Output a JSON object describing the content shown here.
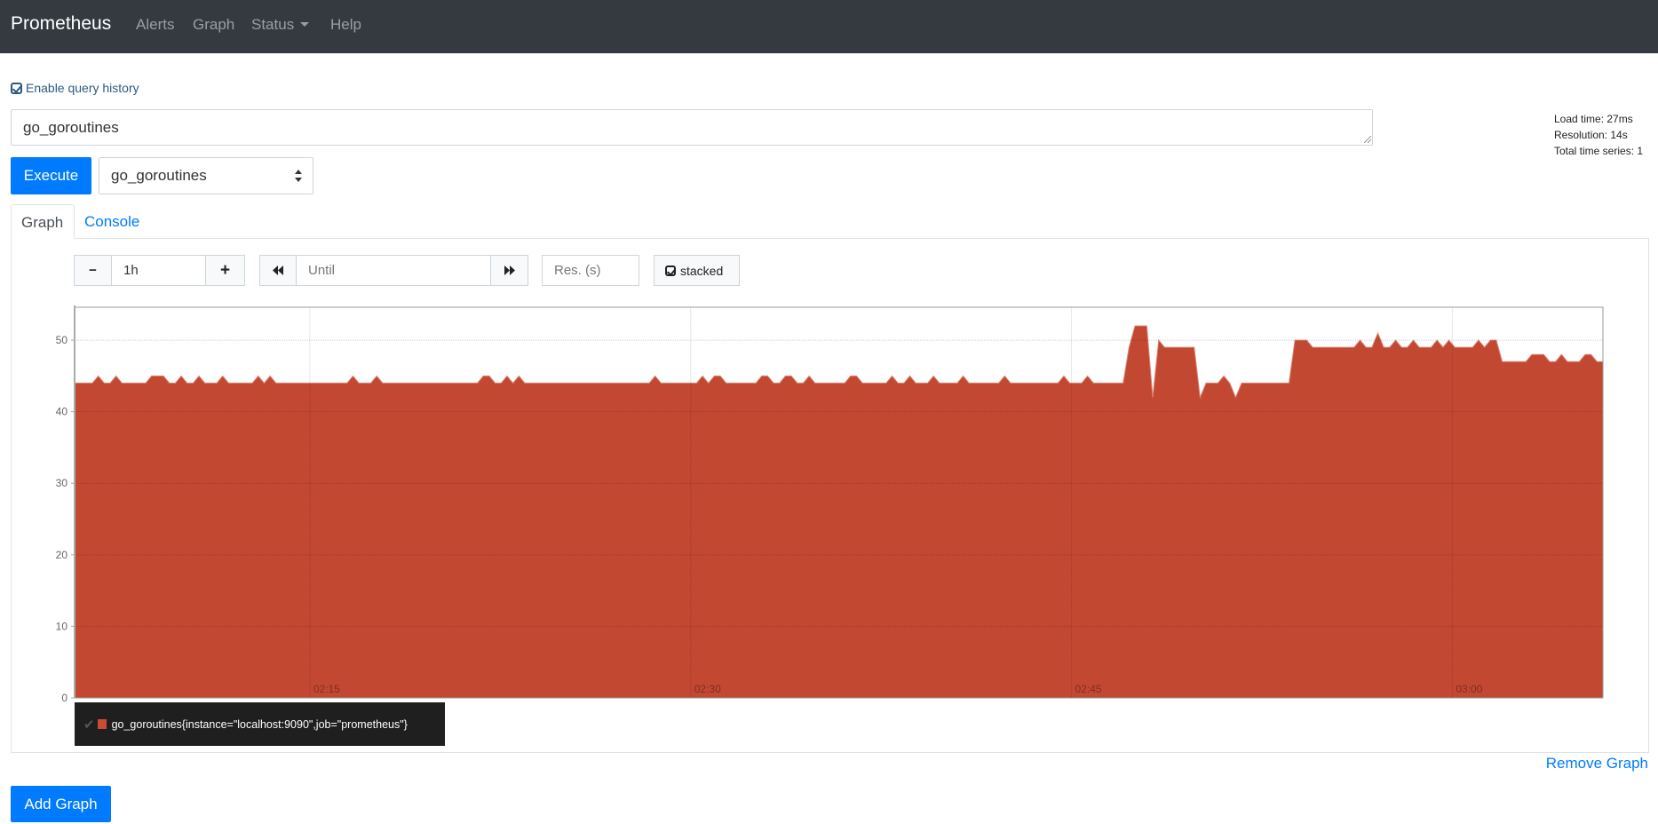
{
  "navbar": {
    "brand": "Prometheus",
    "links": [
      {
        "label": "Alerts"
      },
      {
        "label": "Graph"
      },
      {
        "label": "Status",
        "dropdown": true
      },
      {
        "label": "Help"
      }
    ]
  },
  "query_history": {
    "label": "Enable query history",
    "checked": true,
    "icon": "check-square-icon"
  },
  "query": {
    "value": "go_goroutines"
  },
  "execute_label": "Execute",
  "metric_select": {
    "selected": "go_goroutines"
  },
  "stats": {
    "load_time": "Load time: 27ms",
    "resolution": "Resolution: 14s",
    "total_series": "Total time series: 1"
  },
  "tabs": [
    {
      "label": "Graph",
      "active": true
    },
    {
      "label": "Console",
      "active": false
    }
  ],
  "controls": {
    "minus": "−",
    "range_value": "1h",
    "plus": "+",
    "rewind_icon": "fast-backward-icon",
    "until_placeholder": "Until",
    "forward_icon": "fast-forward-icon",
    "res_placeholder": "Res. (s)",
    "stacked_label": "stacked",
    "stacked_checked": true
  },
  "chart_data": {
    "type": "area",
    "title": "",
    "xlabel": "",
    "ylabel": "",
    "ylim": [
      0,
      54.6
    ],
    "y_ticks": [
      "0",
      "10",
      "20",
      "30",
      "40",
      "50"
    ],
    "y_tick_values": [
      0,
      10,
      20,
      30,
      40,
      50
    ],
    "x_ticks": [
      "02:15",
      "02:30",
      "02:45",
      "03:00"
    ],
    "x_tick_seconds": [
      8100,
      9000,
      9900,
      10800
    ],
    "start_seconds": 7544,
    "step_seconds": 14,
    "grid": true,
    "stacked": true,
    "series": [
      {
        "name": "go_goroutines{instance=\"localhost:9090\",job=\"prometheus\"}",
        "color": "#c24832",
        "values": [
          44,
          44,
          44,
          44,
          45,
          44,
          44,
          45,
          44,
          44,
          44,
          44,
          44,
          45,
          45,
          45,
          44,
          44,
          45,
          44,
          44,
          45,
          44,
          44,
          44,
          45,
          44,
          44,
          44,
          44,
          44,
          45,
          44,
          45,
          44,
          44,
          44,
          44,
          44,
          44,
          44,
          44,
          44,
          44,
          44,
          44,
          44,
          45,
          44,
          44,
          44,
          45,
          44,
          44,
          44,
          44,
          44,
          44,
          44,
          44,
          44,
          44,
          44,
          44,
          44,
          44,
          44,
          44,
          44,
          45,
          45,
          44,
          44,
          45,
          44,
          45,
          44,
          44,
          44,
          44,
          44,
          44,
          44,
          44,
          44,
          44,
          44,
          44,
          44,
          44,
          44,
          44,
          44,
          44,
          44,
          44,
          44,
          44,
          45,
          44,
          44,
          44,
          44,
          44,
          44,
          44,
          45,
          44,
          45,
          45,
          44,
          44,
          44,
          44,
          44,
          44,
          45,
          45,
          44,
          44,
          45,
          45,
          44,
          44,
          45,
          44,
          44,
          44,
          44,
          44,
          44,
          45,
          45,
          44,
          44,
          44,
          44,
          44,
          45,
          44,
          44,
          45,
          44,
          44,
          44,
          45,
          44,
          44,
          44,
          44,
          45,
          44,
          44,
          44,
          44,
          44,
          44,
          45,
          44,
          44,
          44,
          44,
          44,
          44,
          44,
          44,
          44,
          45,
          44,
          44,
          44,
          45,
          44,
          44,
          44,
          44,
          44,
          44,
          49,
          52,
          52,
          52,
          42,
          50,
          49,
          49,
          49,
          49,
          49,
          49,
          42,
          44,
          44,
          44,
          45,
          44,
          42,
          44,
          44,
          44,
          44,
          44,
          44,
          44,
          44,
          44,
          50,
          50,
          50,
          49,
          49,
          49,
          49,
          49,
          49,
          49,
          49,
          50,
          49,
          49,
          51,
          49,
          49,
          50,
          49,
          49,
          50,
          49,
          49,
          49,
          50,
          49,
          50,
          49,
          49,
          49,
          49,
          50,
          49,
          50,
          50,
          47,
          47,
          47,
          47,
          47,
          48,
          48,
          48,
          47,
          47,
          48,
          47,
          47,
          47,
          48,
          48,
          47,
          47
        ]
      }
    ],
    "legend": {
      "position": "bottom-left",
      "entries": [
        "go_goroutines{instance=\"localhost:9090\",job=\"prometheus\"}"
      ]
    }
  },
  "legend_check": "✔",
  "remove_graph_label": "Remove Graph",
  "add_graph_label": "Add Graph"
}
